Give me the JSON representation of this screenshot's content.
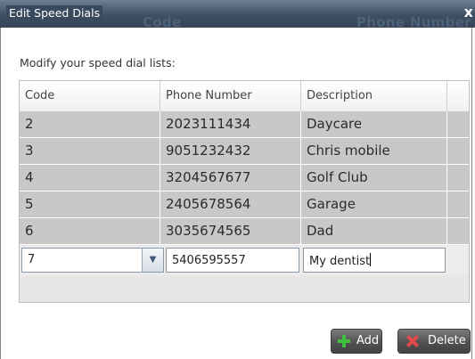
{
  "window": {
    "title": "Edit Speed Dials",
    "ghost_code": "Code",
    "ghost_phone": "Phone Number",
    "close_glyph": "x"
  },
  "subtitle": "Modify your speed dial lists:",
  "table": {
    "columns": [
      "Code",
      "Phone Number",
      "Description"
    ],
    "rows": [
      [
        "2",
        "2023111434",
        "Daycare"
      ],
      [
        "3",
        "9051232432",
        "Chris mobile"
      ],
      [
        "4",
        "3204567677",
        "Golf Club"
      ],
      [
        "5",
        "2405678564",
        "Garage"
      ],
      [
        "6",
        "3035674565",
        "Dad"
      ]
    ],
    "edit_row": {
      "code": "7",
      "phone": "5406595557",
      "description": "My dentist"
    }
  },
  "buttons": {
    "add_label": "Add",
    "delete_label": "Delete"
  },
  "colors": {
    "row_bg": "#c8c8c8",
    "add_icon": "#3ec23e",
    "delete_icon": "#e04b4b"
  },
  "icons": {
    "close": "close-icon",
    "dropdown": "chevron-down-icon",
    "add": "plus-icon",
    "delete": "x-icon"
  }
}
